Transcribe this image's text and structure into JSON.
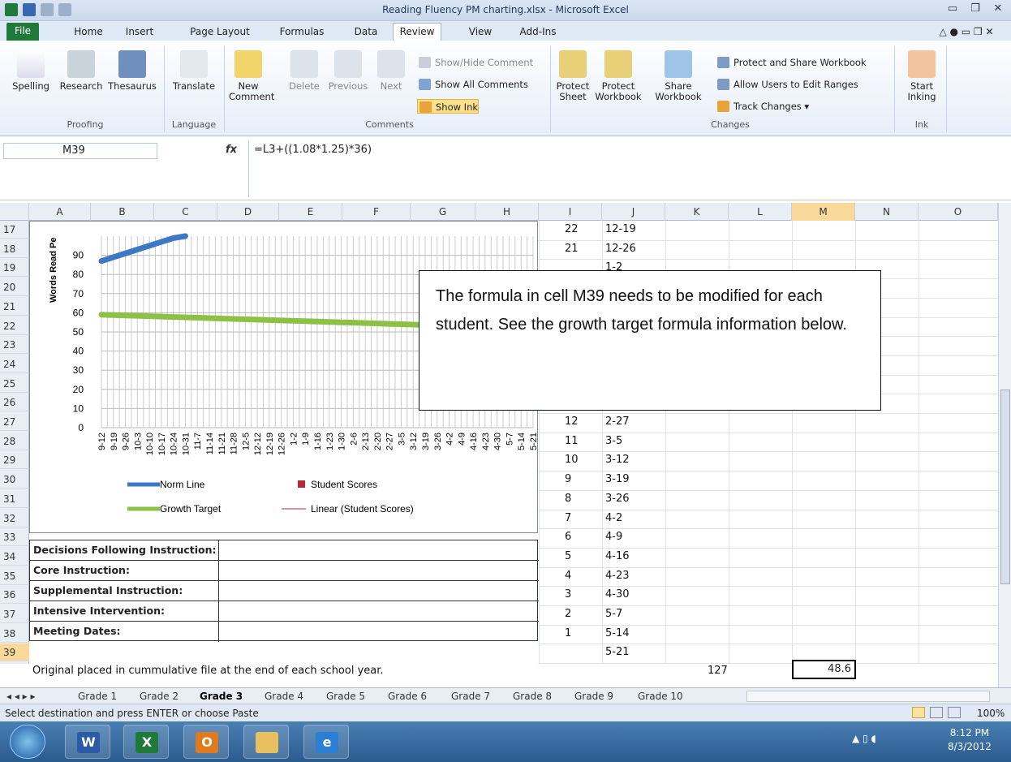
{
  "window": {
    "title": "Reading Fluency PM charting.xlsx - Microsoft Excel"
  },
  "tabs": [
    "File",
    "Home",
    "Insert",
    "Page Layout",
    "Formulas",
    "Data",
    "Review",
    "View",
    "Add-Ins"
  ],
  "ribbon": {
    "proofing": {
      "spelling": "Spelling",
      "research": "Research",
      "thesaurus": "Thesaurus",
      "group": "Proofing"
    },
    "language": {
      "translate": "Translate",
      "group": "Language"
    },
    "comments": {
      "new": "New",
      "new2": "Comment",
      "delete": "Delete",
      "previous": "Previous",
      "next": "Next",
      "show_hide": "Show/Hide Comment",
      "show_all": "Show All Comments",
      "show_ink": "Show Ink",
      "group": "Comments"
    },
    "changes": {
      "protect_sheet": "Protect",
      "protect_sheet2": "Sheet",
      "protect_wb": "Protect",
      "protect_wb2": "Workbook",
      "share_wb": "Share",
      "share_wb2": "Workbook",
      "protect_share": "Protect and Share Workbook",
      "allow_users": "Allow Users to Edit Ranges",
      "track": "Track Changes",
      "group": "Changes"
    },
    "ink": {
      "start": "Start",
      "start2": "Inking",
      "group": "Ink"
    }
  },
  "formula_bar": {
    "name_box": "M39",
    "fx": "fx",
    "formula": "=L3+((1.08*1.25)*36)"
  },
  "columns": [
    "A",
    "B",
    "C",
    "D",
    "E",
    "F",
    "G",
    "H",
    "I",
    "J",
    "K",
    "L",
    "M",
    "N",
    "O"
  ],
  "rows": [
    "17",
    "18",
    "19",
    "20",
    "21",
    "22",
    "23",
    "24",
    "25",
    "26",
    "27",
    "28",
    "29",
    "30",
    "31",
    "32",
    "33",
    "34",
    "35",
    "36",
    "37",
    "38",
    "39"
  ],
  "col_i": [
    "22",
    "21",
    "",
    "",
    "",
    "",
    "",
    "",
    "",
    "13",
    "12",
    "11",
    "10",
    "9",
    "8",
    "7",
    "6",
    "5",
    "4",
    "3",
    "2",
    "1",
    ""
  ],
  "col_j": [
    "12-19",
    "12-26",
    "1-2",
    "",
    "",
    "",
    "",
    "",
    "",
    "2-20",
    "2-27",
    "3-5",
    "3-12",
    "3-19",
    "3-26",
    "4-2",
    "4-9",
    "4-16",
    "4-23",
    "4-30",
    "5-7",
    "5-14",
    "5-21"
  ],
  "row39": {
    "a": "Original placed in cummulative file at the end of each school year.",
    "k": "127",
    "m": "48.6"
  },
  "decisions": [
    "Decisions Following Instruction:",
    "Core Instruction:",
    "Supplemental Instruction:",
    "Intensive Intervention:",
    "Meeting Dates:"
  ],
  "callout": "The formula in cell M39 needs to be modified for each student.  See the growth target formula information below.",
  "chart_data": {
    "type": "line",
    "ylabel": "Words Read Pe",
    "yticks": [
      0,
      10,
      20,
      30,
      40,
      50,
      60,
      70,
      80,
      90
    ],
    "categories": [
      "9-12",
      "9-19",
      "9-26",
      "10-3",
      "10-10",
      "10-17",
      "10-24",
      "10-31",
      "11-7",
      "11-14",
      "11-21",
      "11-28",
      "12-5",
      "12-12",
      "12-19",
      "12-26",
      "1-2",
      "1-9",
      "1-16",
      "1-23",
      "1-30",
      "2-6",
      "2-13",
      "2-20",
      "2-27",
      "3-5",
      "3-12",
      "3-19",
      "3-26",
      "4-2",
      "4-9",
      "4-16",
      "4-23",
      "4-30",
      "5-7",
      "5-14",
      "5-21"
    ],
    "series": [
      {
        "name": "Norm Line",
        "color": "#3c78c4",
        "values": [
          87,
          89,
          91,
          93,
          95,
          97,
          99,
          100
        ]
      },
      {
        "name": "Growth Target",
        "color": "#8dc146",
        "values": [
          59,
          58.8,
          58.6,
          58.4,
          58.2,
          58,
          57.8,
          57.6,
          57.4,
          57.2,
          57,
          56.8,
          56.6,
          56.4,
          56.2,
          56,
          55.8,
          55.6,
          55.4,
          55.2,
          55,
          54.8,
          54.6,
          54.4,
          54.2,
          54,
          53.8,
          53.6,
          53.4,
          53.2,
          53,
          52.8,
          52.6,
          52.4,
          52.2,
          52,
          51.8
        ]
      }
    ],
    "legend": [
      "Norm Line",
      "Student Scores",
      "Growth Target",
      "Linear (Student Scores)"
    ],
    "ylim": [
      0,
      100
    ]
  },
  "sheets": [
    "Grade 1",
    "Grade 2",
    "Grade 3",
    "Grade 4",
    "Grade 5",
    "Grade 6",
    "Grade 7",
    "Grade 8",
    "Grade 9",
    "Grade 10"
  ],
  "status": {
    "text": "Select destination and press ENTER or choose Paste",
    "zoom": "100%"
  },
  "taskbar": {
    "time": "8:12 PM",
    "date": "8/3/2012"
  }
}
